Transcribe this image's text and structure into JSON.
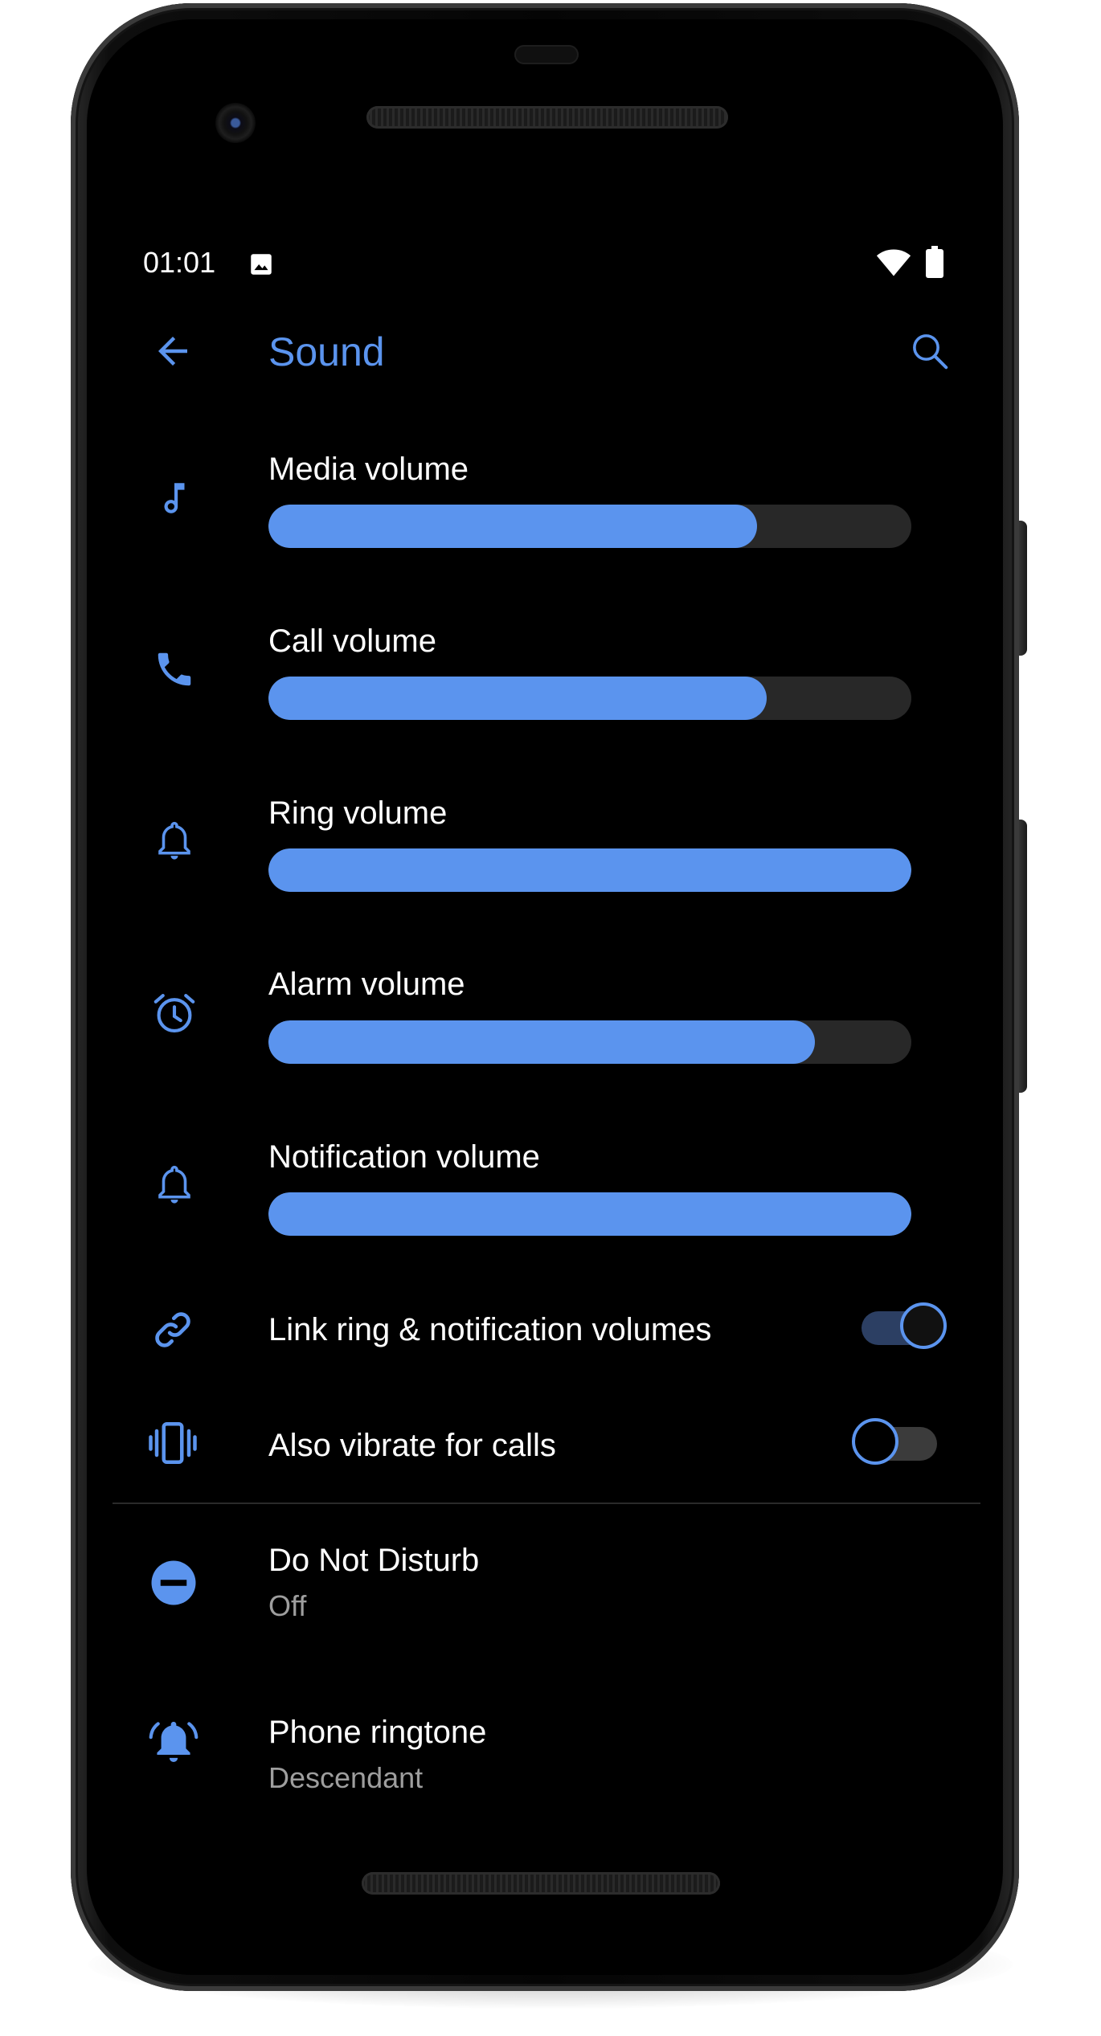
{
  "colors": {
    "accent": "#5b94ee",
    "background": "#000000",
    "track": "#282828",
    "subtext": "#9e9e9e"
  },
  "status_bar": {
    "time": "01:01",
    "icons": [
      "image-icon",
      "wifi-icon",
      "battery-icon"
    ]
  },
  "app_bar": {
    "title": "Sound",
    "back_icon": "arrow-back-icon",
    "search_icon": "search-icon"
  },
  "volume_sliders": [
    {
      "label": "Media volume",
      "icon": "music-note-icon",
      "level": 0.76
    },
    {
      "label": "Call volume",
      "icon": "phone-icon",
      "level": 0.775
    },
    {
      "label": "Ring volume",
      "icon": "bell-icon",
      "level": 1.0
    },
    {
      "label": "Alarm volume",
      "icon": "alarm-clock-icon",
      "level": 0.85
    },
    {
      "label": "Notification volume",
      "icon": "bell-icon",
      "level": 1.0
    }
  ],
  "toggles": [
    {
      "label": "Link ring & notification volumes",
      "icon": "link-icon",
      "on": true
    },
    {
      "label": "Also vibrate for calls",
      "icon": "vibrate-icon",
      "on": false
    }
  ],
  "settings": [
    {
      "title": "Do Not Disturb",
      "value": "Off",
      "icon": "do-not-disturb-icon"
    },
    {
      "title": "Phone ringtone",
      "value": "Descendant",
      "icon": "ringing-bell-icon"
    }
  ]
}
